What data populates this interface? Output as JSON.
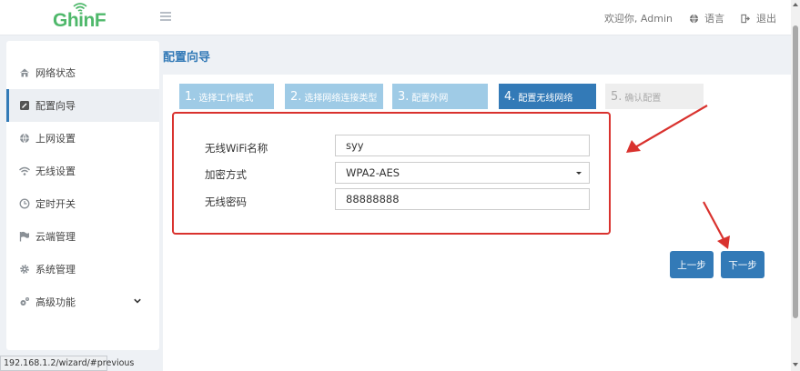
{
  "brand": {
    "logo_text": "GhinF",
    "color": "#4fb86b"
  },
  "header": {
    "welcome": "欢迎你, Admin",
    "language_label": "语言",
    "logout_label": "退出",
    "language_icon": "globe-icon",
    "logout_icon": "logout-icon"
  },
  "sidebar": {
    "items": [
      {
        "label": "网络状态",
        "icon": "home-icon"
      },
      {
        "label": "配置向导",
        "icon": "wizard-icon",
        "active": true
      },
      {
        "label": "上网设置",
        "icon": "globe-icon"
      },
      {
        "label": "无线设置",
        "icon": "wifi-icon"
      },
      {
        "label": "定时开关",
        "icon": "clock-icon"
      },
      {
        "label": "云端管理",
        "icon": "flag-icon"
      },
      {
        "label": "系统管理",
        "icon": "gear-icon"
      },
      {
        "label": "高级功能",
        "icon": "gears-icon"
      }
    ]
  },
  "status_url": "192.168.1.2/wizard/#previous",
  "page": {
    "title": "配置向导"
  },
  "steps": [
    {
      "num": "1.",
      "label": "选择工作模式",
      "state": "done"
    },
    {
      "num": "2.",
      "label": "选择网络连接类型",
      "state": "done"
    },
    {
      "num": "3.",
      "label": "配置外网",
      "state": "done"
    },
    {
      "num": "4.",
      "label": "配置无线网络",
      "state": "current"
    },
    {
      "num": "5.",
      "label": "确认配置",
      "state": "todo"
    }
  ],
  "form": {
    "ssid": {
      "label": "无线WiFi名称",
      "value": "syy"
    },
    "encryption": {
      "label": "加密方式",
      "value": "WPA2-AES"
    },
    "password": {
      "label": "无线密码",
      "value": "88888888"
    }
  },
  "buttons": {
    "prev": "上一步",
    "next": "下一步"
  },
  "colors": {
    "primary": "#337ab7",
    "step_done": "#9fcbe6",
    "highlight": "#d9322e"
  }
}
